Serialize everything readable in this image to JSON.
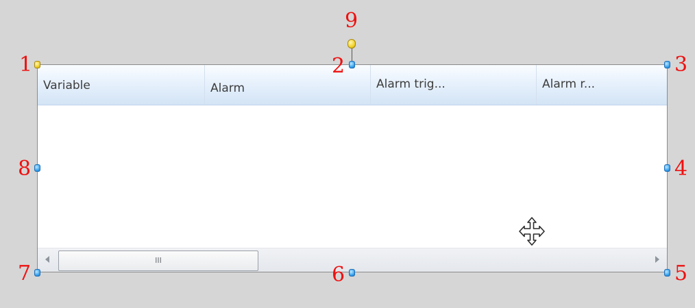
{
  "table": {
    "columns": [
      {
        "label": "Variable"
      },
      {
        "label": "Alarm"
      },
      {
        "label": "Alarm trig..."
      },
      {
        "label": "Alarm r..."
      }
    ],
    "scrollbar_grip": "III"
  },
  "handles": {
    "labels": [
      "1",
      "2",
      "3",
      "4",
      "5",
      "6",
      "7",
      "8",
      "9"
    ]
  },
  "colors": {
    "background": "#d6d6d6",
    "label": "#ee1111",
    "handle_blue": "#3ea6ef",
    "handle_yellow": "#f3d22a"
  },
  "icons": [
    "move-cursor-icon",
    "scroll-left-arrow-icon",
    "scroll-right-arrow-icon"
  ]
}
